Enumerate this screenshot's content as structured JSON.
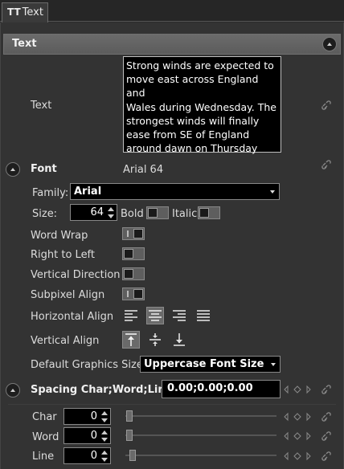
{
  "tab": {
    "icon": "text-type-icon",
    "icon_glyph": "TT",
    "label": "Text"
  },
  "section": {
    "title": "Text"
  },
  "text_field": {
    "label": "Text",
    "value": "Strong winds are expected to\nmove east across England and\nWales during Wednesday. The\nstrongest winds will finally\nease from SE of England\naround dawn on Thursday"
  },
  "font": {
    "label": "Font",
    "summary": "Arial 64",
    "family_label": "Family:",
    "family_value": "Arial",
    "size_label": "Size:",
    "size_value": "64",
    "bold_label": "Bold",
    "italic_label": "Italic",
    "bold_on": false,
    "italic_on": false
  },
  "options": {
    "word_wrap": {
      "label": "Word Wrap",
      "on": true
    },
    "right_to_left": {
      "label": "Right to Left",
      "on": false
    },
    "vertical_direction": {
      "label": "Vertical Direction",
      "on": false
    },
    "subpixel_align": {
      "label": "Subpixel Align",
      "on": true
    }
  },
  "horizontal_align": {
    "label": "Horizontal Align",
    "options": [
      "left",
      "center",
      "right",
      "justify"
    ],
    "selected": "center"
  },
  "vertical_align": {
    "label": "Vertical Align",
    "options": [
      "top",
      "middle",
      "bottom"
    ],
    "selected": "top"
  },
  "default_graphics_size": {
    "label": "Default Graphics Size",
    "value": "Uppercase Font Size"
  },
  "spacing": {
    "label": "Spacing Char;Word;Line",
    "value": "0.00;0.00;0.00",
    "char": {
      "label": "Char",
      "value": "0"
    },
    "word": {
      "label": "Word",
      "value": "0"
    },
    "line": {
      "label": "Line",
      "value": "0"
    }
  },
  "colors": {
    "panel": "#333333",
    "header": "#5c5c5c",
    "field_bg": "#000000",
    "text": "#dcdcdc"
  }
}
